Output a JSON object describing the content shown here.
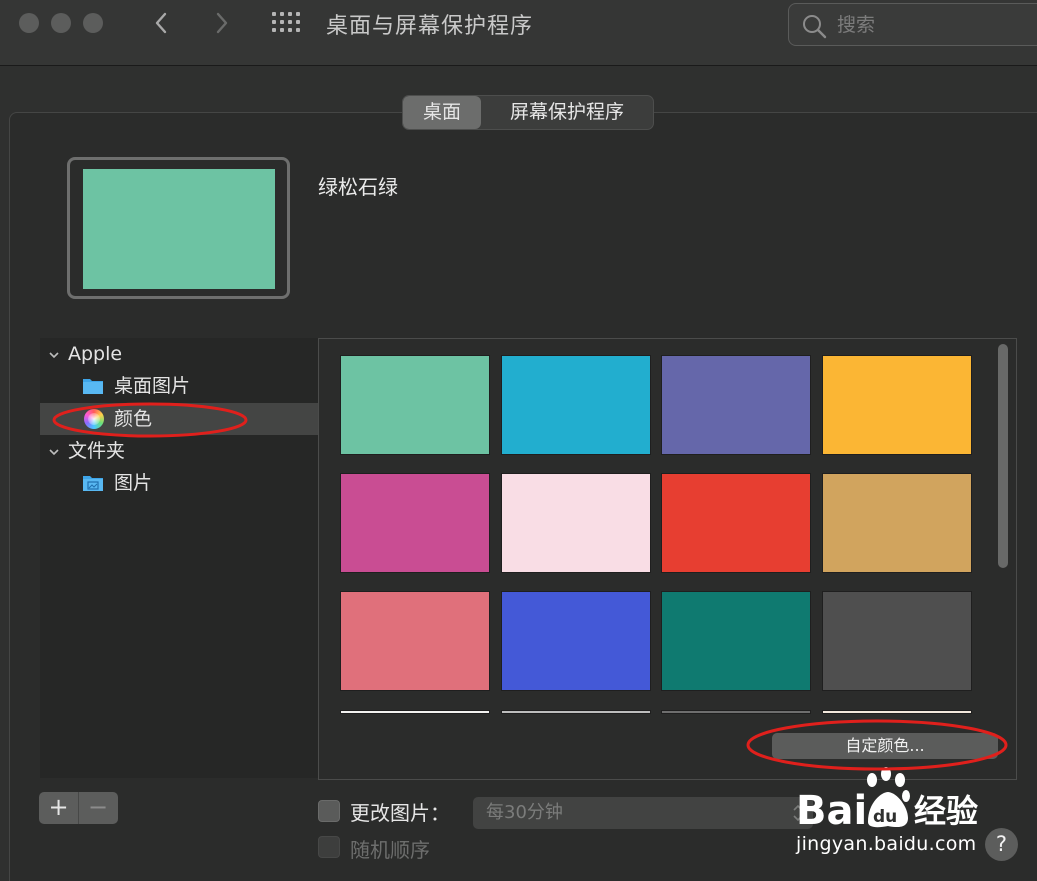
{
  "window": {
    "title": "桌面与屏幕保护程序",
    "search_placeholder": "搜索",
    "icons": [
      "back-arrow-icon",
      "forward-arrow-icon",
      "show-all-grid-icon",
      "search-icon"
    ]
  },
  "tabs": [
    {
      "label": "桌面",
      "active": true
    },
    {
      "label": "屏幕保护程序",
      "active": false
    }
  ],
  "preview": {
    "color_name": "绿松石绿",
    "color": "#6dc3a3"
  },
  "sidebar": {
    "groups": [
      {
        "label": "Apple",
        "expanded": true,
        "items": [
          {
            "label": "桌面图片",
            "icon": "folder-icon",
            "selected": false
          },
          {
            "label": "颜色",
            "icon": "color-wheel-icon",
            "selected": true
          }
        ]
      },
      {
        "label": "文件夹",
        "expanded": true,
        "items": [
          {
            "label": "图片",
            "icon": "pictures-folder-icon",
            "selected": false
          }
        ]
      }
    ]
  },
  "swatches": [
    "#6dc3a3",
    "#22aecf",
    "#6567aa",
    "#fbb634",
    "#c94d93",
    "#f9dde5",
    "#e73e31",
    "#d1a45e",
    "#e0707b",
    "#4459d7",
    "#0f7a70",
    "#4f4f4f"
  ],
  "partial_swatches": [
    "#f2f2f0",
    "#bdbdbd",
    "#6e6e6e",
    "#f2e8dc"
  ],
  "custom_color_button": "自定颜色...",
  "bottom": {
    "add_label": "+",
    "remove_label": "−",
    "change_picture_label": "更改图片：",
    "change_picture_checked": false,
    "interval_value": "每30分钟",
    "random_order_label": "随机顺序",
    "random_order_enabled": false
  },
  "watermark": {
    "brand": "Bai du 经验",
    "url": "jingyan.baidu.com"
  },
  "help_label": "?",
  "annotation_color": "#e0201c"
}
